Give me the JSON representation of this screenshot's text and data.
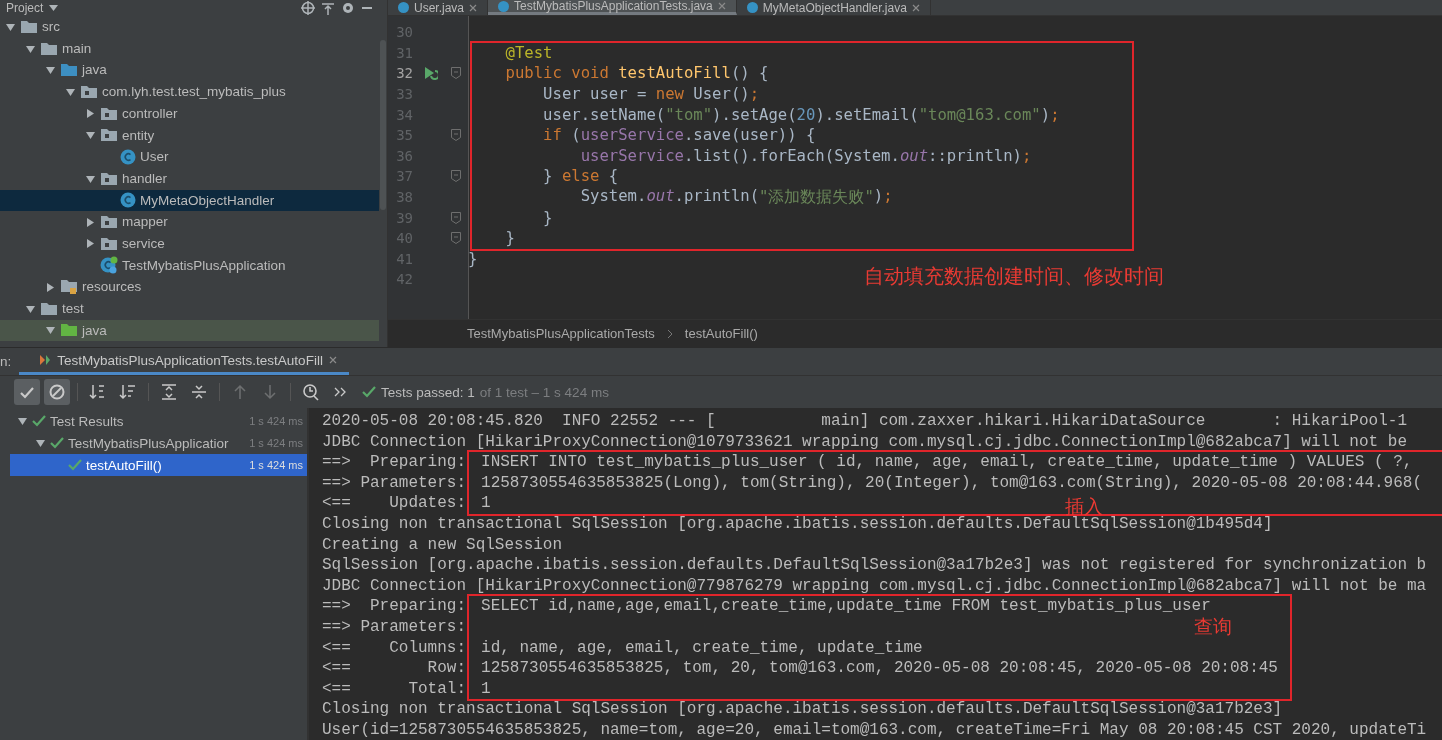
{
  "project": {
    "title": "Project",
    "tree": [
      {
        "name": "src",
        "kind": "folder",
        "expanded": true,
        "selected": false,
        "children": [
          {
            "name": "main",
            "kind": "folder",
            "expanded": true,
            "selected": false,
            "children": [
              {
                "name": "java",
                "kind": "source-root",
                "expanded": true,
                "selected": false,
                "children": [
                  {
                    "name": "com.lyh.test.test_mybatis_plus",
                    "kind": "package",
                    "expanded": true,
                    "selected": false,
                    "children": [
                      {
                        "name": "controller",
                        "kind": "package",
                        "expanded": false,
                        "selected": false
                      },
                      {
                        "name": "entity",
                        "kind": "package",
                        "expanded": true,
                        "selected": false,
                        "children": [
                          {
                            "name": "User",
                            "kind": "class",
                            "selected": false
                          }
                        ]
                      },
                      {
                        "name": "handler",
                        "kind": "package",
                        "expanded": true,
                        "selected": false,
                        "children": [
                          {
                            "name": "MyMetaObjectHandler",
                            "kind": "class",
                            "selected": true
                          }
                        ]
                      },
                      {
                        "name": "mapper",
                        "kind": "package",
                        "expanded": false,
                        "selected": false
                      },
                      {
                        "name": "service",
                        "kind": "package",
                        "expanded": false,
                        "selected": false
                      },
                      {
                        "name": "TestMybatisPlusApplication",
                        "kind": "app-class",
                        "selected": false
                      }
                    ]
                  }
                ]
              },
              {
                "name": "resources",
                "kind": "resources",
                "expanded": false,
                "selected": false
              }
            ]
          },
          {
            "name": "test",
            "kind": "folder",
            "expanded": true,
            "selected": false,
            "children": [
              {
                "name": "java",
                "kind": "test-root",
                "expanded": true,
                "selected": false
              }
            ]
          }
        ]
      }
    ]
  },
  "editor_tabs": [
    {
      "label": "User.java",
      "selected": false
    },
    {
      "label": "TestMybatisPlusApplicationTests.java",
      "selected": true
    },
    {
      "label": "MyMetaObjectHandler.java",
      "selected": false
    }
  ],
  "editor": {
    "items": [
      {
        "kind": "line",
        "number": "30",
        "fold": false
      },
      {
        "kind": "highlight",
        "label": "自动填充数据创建时间、修改时间",
        "lines": [
          {
            "number": "31",
            "fold": false,
            "tokens": [
              {
                "t": "    @Test",
                "kind": "annotation"
              }
            ]
          },
          {
            "number": "32",
            "fold": true,
            "run": true,
            "tokens": [
              {
                "t": "    public void ",
                "kind": "keyword"
              },
              {
                "t": "testAutoFill",
                "kind": "method"
              },
              {
                "t": "() {",
                "kind": "plain"
              }
            ]
          },
          {
            "number": "33",
            "fold": false,
            "tokens": [
              {
                "t": "        User user = ",
                "kind": "plain"
              },
              {
                "t": "new ",
                "kind": "keyword"
              },
              {
                "t": "User()",
                "kind": "plain"
              },
              {
                "t": ";",
                "kind": "keyword"
              }
            ]
          },
          {
            "number": "34",
            "fold": false,
            "tokens": [
              {
                "t": "        user.setName(",
                "kind": "plain"
              },
              {
                "t": "\"tom\"",
                "kind": "string"
              },
              {
                "t": ").setAge(",
                "kind": "plain"
              },
              {
                "t": "20",
                "kind": "number"
              },
              {
                "t": ").setEmail(",
                "kind": "plain"
              },
              {
                "t": "\"tom@163.com\"",
                "kind": "string"
              },
              {
                "t": ")",
                "kind": "plain"
              },
              {
                "t": ";",
                "kind": "keyword"
              }
            ]
          },
          {
            "number": "35",
            "fold": true,
            "tokens": [
              {
                "t": "        if ",
                "kind": "keyword"
              },
              {
                "t": "(",
                "kind": "plain"
              },
              {
                "t": "userService",
                "kind": "field"
              },
              {
                "t": ".save(user)) {",
                "kind": "plain"
              }
            ]
          },
          {
            "number": "36",
            "fold": false,
            "tokens": [
              {
                "t": "            userService",
                "kind": "field"
              },
              {
                "t": ".list().forEach(System.",
                "kind": "plain"
              },
              {
                "t": "out",
                "kind": "static"
              },
              {
                "t": "::println)",
                "kind": "plain"
              },
              {
                "t": ";",
                "kind": "keyword"
              }
            ]
          },
          {
            "number": "37",
            "fold": true,
            "tokens": [
              {
                "t": "        } ",
                "kind": "plain"
              },
              {
                "t": "else ",
                "kind": "keyword"
              },
              {
                "t": "{",
                "kind": "plain"
              }
            ]
          },
          {
            "number": "38",
            "fold": false,
            "tokens": [
              {
                "t": "            System.",
                "kind": "plain"
              },
              {
                "t": "out",
                "kind": "static"
              },
              {
                "t": ".println(",
                "kind": "plain"
              },
              {
                "t": "\"添加数据失败\"",
                "kind": "string"
              },
              {
                "t": ")",
                "kind": "plain"
              },
              {
                "t": ";",
                "kind": "keyword"
              }
            ]
          },
          {
            "number": "39",
            "fold": true,
            "tokens": [
              {
                "t": "        }",
                "kind": "plain"
              }
            ]
          },
          {
            "number": "40",
            "fold": true,
            "tokens": [
              {
                "t": "    }",
                "kind": "plain"
              }
            ]
          }
        ]
      },
      {
        "kind": "line",
        "number": "41",
        "fold": false,
        "tokens": [
          {
            "t": "}",
            "kind": "plain"
          }
        ]
      },
      {
        "kind": "line",
        "number": "42",
        "fold": false
      }
    ]
  },
  "breadcrumb": [
    "TestMybatisPlusApplicationTests",
    "testAutoFill()"
  ],
  "run": {
    "label": "n:",
    "tab": "TestMybatisPlusApplicationTests.testAutoFill",
    "toolbar": [
      {
        "kind": "check",
        "on": true,
        "disabled": false
      },
      {
        "kind": "stop",
        "on": true,
        "disabled": false
      },
      {
        "kind": "sort-alpha",
        "on": false,
        "disabled": false
      },
      {
        "kind": "sort-duration",
        "on": false,
        "disabled": false
      },
      {
        "kind": "expand-all",
        "on": false,
        "disabled": false
      },
      {
        "kind": "collapse-all",
        "on": false,
        "disabled": false
      },
      {
        "kind": "up",
        "on": false,
        "disabled": true
      },
      {
        "kind": "down",
        "on": false,
        "disabled": true
      },
      {
        "kind": "clock",
        "on": false,
        "disabled": false
      },
      {
        "kind": "more",
        "on": false,
        "disabled": false
      }
    ],
    "status": {
      "passed": "Tests passed: 1",
      "detail": "of 1 test – 1 s 424 ms"
    },
    "tests": [
      {
        "name": "Test Results",
        "time": "1 s 424 ms",
        "passed": true,
        "expanded": true,
        "selected": false,
        "children": [
          {
            "name": "TestMybatisPlusApplicatior",
            "time": "1 s 424 ms",
            "passed": true,
            "expanded": true,
            "selected": false,
            "children": [
              {
                "name": "testAutoFill()",
                "time": "1 s 424 ms",
                "passed": true,
                "selected": true
              }
            ]
          }
        ]
      }
    ],
    "console": [
      {
        "kind": "line",
        "text": "2020-05-08 20:08:45.820  INFO 22552 --- [           main] com.zaxxer.hikari.HikariDataSource       : HikariPool-1"
      },
      {
        "kind": "line",
        "text": "JDBC Connection [HikariProxyConnection@1079733621 wrapping com.mysql.cj.jdbc.ConnectionImpl@682abca7] will not be"
      },
      {
        "kind": "highlight",
        "label": "插入",
        "extends": true,
        "lines": [
          {
            "prefix": "==>  Preparing:",
            "text": "INSERT INTO test_mybatis_plus_user ( id, name, age, email, create_time, update_time ) VALUES ( ?,"
          },
          {
            "prefix": "==> Parameters:",
            "text": "1258730554635853825(Long), tom(String), 20(Integer), tom@163.com(String), 2020-05-08 20:08:44.968("
          },
          {
            "prefix": "<==    Updates:",
            "text": "1"
          }
        ]
      },
      {
        "kind": "line",
        "text": "Closing non transactional SqlSession [org.apache.ibatis.session.defaults.DefaultSqlSession@1b495d4]"
      },
      {
        "kind": "line",
        "text": "Creating a new SqlSession"
      },
      {
        "kind": "line",
        "text": "SqlSession [org.apache.ibatis.session.defaults.DefaultSqlSession@3a17b2e3] was not registered for synchronization b"
      },
      {
        "kind": "line",
        "text": "JDBC Connection [HikariProxyConnection@779876279 wrapping com.mysql.cj.jdbc.ConnectionImpl@682abca7] will not be ma"
      },
      {
        "kind": "highlight",
        "label": "查询",
        "extends": false,
        "lines": [
          {
            "prefix": "==>  Preparing:",
            "text": "SELECT id,name,age,email,create_time,update_time FROM test_mybatis_plus_user"
          },
          {
            "prefix": "==> Parameters:"
          },
          {
            "prefix": "<==    Columns:",
            "text": "id, name, age, email, create_time, update_time"
          },
          {
            "prefix": "<==        Row:",
            "text": "1258730554635853825, tom, 20, tom@163.com, 2020-05-08 20:08:45, 2020-05-08 20:08:45"
          },
          {
            "prefix": "<==      Total:",
            "text": "1"
          }
        ]
      },
      {
        "kind": "line",
        "text": "Closing non transactional SqlSession [org.apache.ibatis.session.defaults.DefaultSqlSession@3a17b2e3]"
      },
      {
        "kind": "line",
        "text": "User(id=1258730554635853825, name=tom, age=20, email=tom@163.com, createTime=Fri May 08 20:08:45 CST 2020, updateTi"
      }
    ]
  }
}
